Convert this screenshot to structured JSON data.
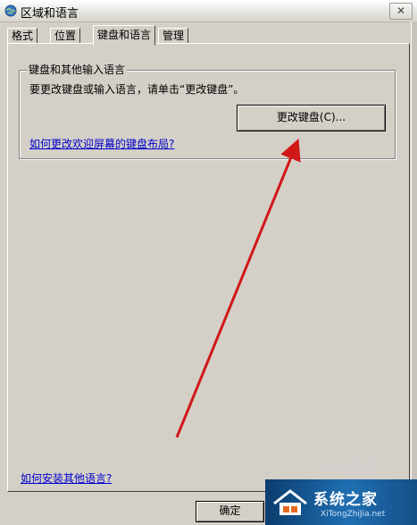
{
  "window": {
    "title": "区域和语言",
    "close_label": "✕"
  },
  "tabs": [
    {
      "label": "格式"
    },
    {
      "label": "位置"
    },
    {
      "label": "键盘和语言",
      "active": true
    },
    {
      "label": "管理"
    }
  ],
  "group": {
    "title": "键盘和其他输入语言",
    "instruction": "要更改键盘或输入语言，请单击“更改键盘”。",
    "change_keyboard_button": "更改键盘(C)...",
    "welcome_link": "如何更改欢迎屏幕的键盘布局?"
  },
  "install_link": "如何安装其他语言?",
  "ok_button": "确定",
  "watermark": {
    "text": "Bai经验"
  },
  "logo": {
    "text": "系统之家",
    "url": "XiTongZhiJia.net"
  },
  "colors": {
    "arrow": "#d01818",
    "link": "#0000cc",
    "dialog_bg": "#d4d0c8"
  }
}
